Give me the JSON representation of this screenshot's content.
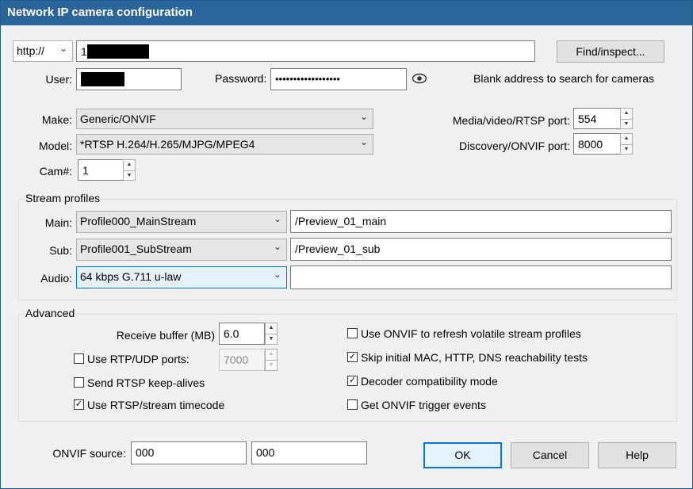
{
  "window": {
    "title": "Network IP camera configuration"
  },
  "address": {
    "protocol": "http://",
    "value_prefix": "1",
    "find_button": "Find/inspect..."
  },
  "auth": {
    "user_label": "User:",
    "password_label": "Password:",
    "password_mask": "••••••••••••••••••",
    "hint": "Blank address to search for cameras"
  },
  "device": {
    "make_label": "Make:",
    "make_value": "Generic/ONVIF",
    "model_label": "Model:",
    "model_value": "*RTSP H.264/H.265/MJPG/MPEG4",
    "cam_label": "Cam#:",
    "cam_value": "1",
    "media_port_label": "Media/video/RTSP port:",
    "media_port_value": "554",
    "discovery_port_label": "Discovery/ONVIF port:",
    "discovery_port_value": "8000"
  },
  "stream_profiles": {
    "title": "Stream profiles",
    "main_label": "Main:",
    "main_profile": "Profile000_MainStream",
    "main_path": "/Preview_01_main",
    "sub_label": "Sub:",
    "sub_profile": "Profile001_SubStream",
    "sub_path": "/Preview_01_sub",
    "audio_label": "Audio:",
    "audio_profile": "64 kbps G.711 u-law",
    "audio_path": ""
  },
  "advanced": {
    "title": "Advanced",
    "receive_buffer_label": "Receive buffer (MB)",
    "receive_buffer_value": "6.0",
    "rtp_udp_label": "Use RTP/UDP ports:",
    "rtp_udp_checked": false,
    "rtp_udp_value": "7000",
    "keepalive_label": "Send RTSP keep-alives",
    "keepalive_checked": false,
    "timecode_label": "Use RTSP/stream timecode",
    "timecode_checked": true,
    "onvif_refresh_label": "Use ONVIF to refresh volatile stream profiles",
    "onvif_refresh_checked": false,
    "skip_tests_label": "Skip initial MAC, HTTP, DNS reachability tests",
    "skip_tests_checked": true,
    "decoder_compat_label": "Decoder compatibility mode",
    "decoder_compat_checked": true,
    "trigger_events_label": "Get ONVIF trigger events",
    "trigger_events_checked": false
  },
  "onvif_source": {
    "label": "ONVIF source:",
    "value1": "000",
    "value2": "000"
  },
  "buttons": {
    "ok": "OK",
    "cancel": "Cancel",
    "help": "Help"
  }
}
